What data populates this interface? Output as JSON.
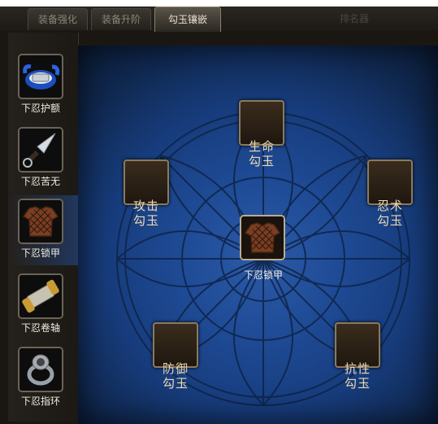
{
  "tabs": [
    {
      "label": "装备强化"
    },
    {
      "label": "装备升阶"
    },
    {
      "label": "勾玉镶嵌",
      "active": true
    },
    {
      "label": "排名器"
    }
  ],
  "equipment": [
    {
      "label": "下忍护额",
      "icon": "headband-icon"
    },
    {
      "label": "下忍苦无",
      "icon": "kunai-icon"
    },
    {
      "label": "下忍锁甲",
      "icon": "chainmail-icon",
      "selected": true
    },
    {
      "label": "下忍卷轴",
      "icon": "scroll-icon"
    },
    {
      "label": "下忍指环",
      "icon": "ring-icon"
    }
  ],
  "gems": {
    "life": {
      "line1": "生命",
      "line2": "勾玉"
    },
    "attack": {
      "line1": "攻击",
      "line2": "勾玉"
    },
    "ninjutsu": {
      "line1": "忍术",
      "line2": "勾玉"
    },
    "defense": {
      "line1": "防御",
      "line2": "勾玉"
    },
    "resist": {
      "line1": "抗性",
      "line2": "勾玉"
    }
  },
  "center": {
    "label": "下忍锁甲",
    "icon": "chainmail-icon"
  },
  "colors": {
    "panel_blue": "#1e4a94",
    "gem_text": "#ecd9b4",
    "frame": "#1a1713"
  }
}
